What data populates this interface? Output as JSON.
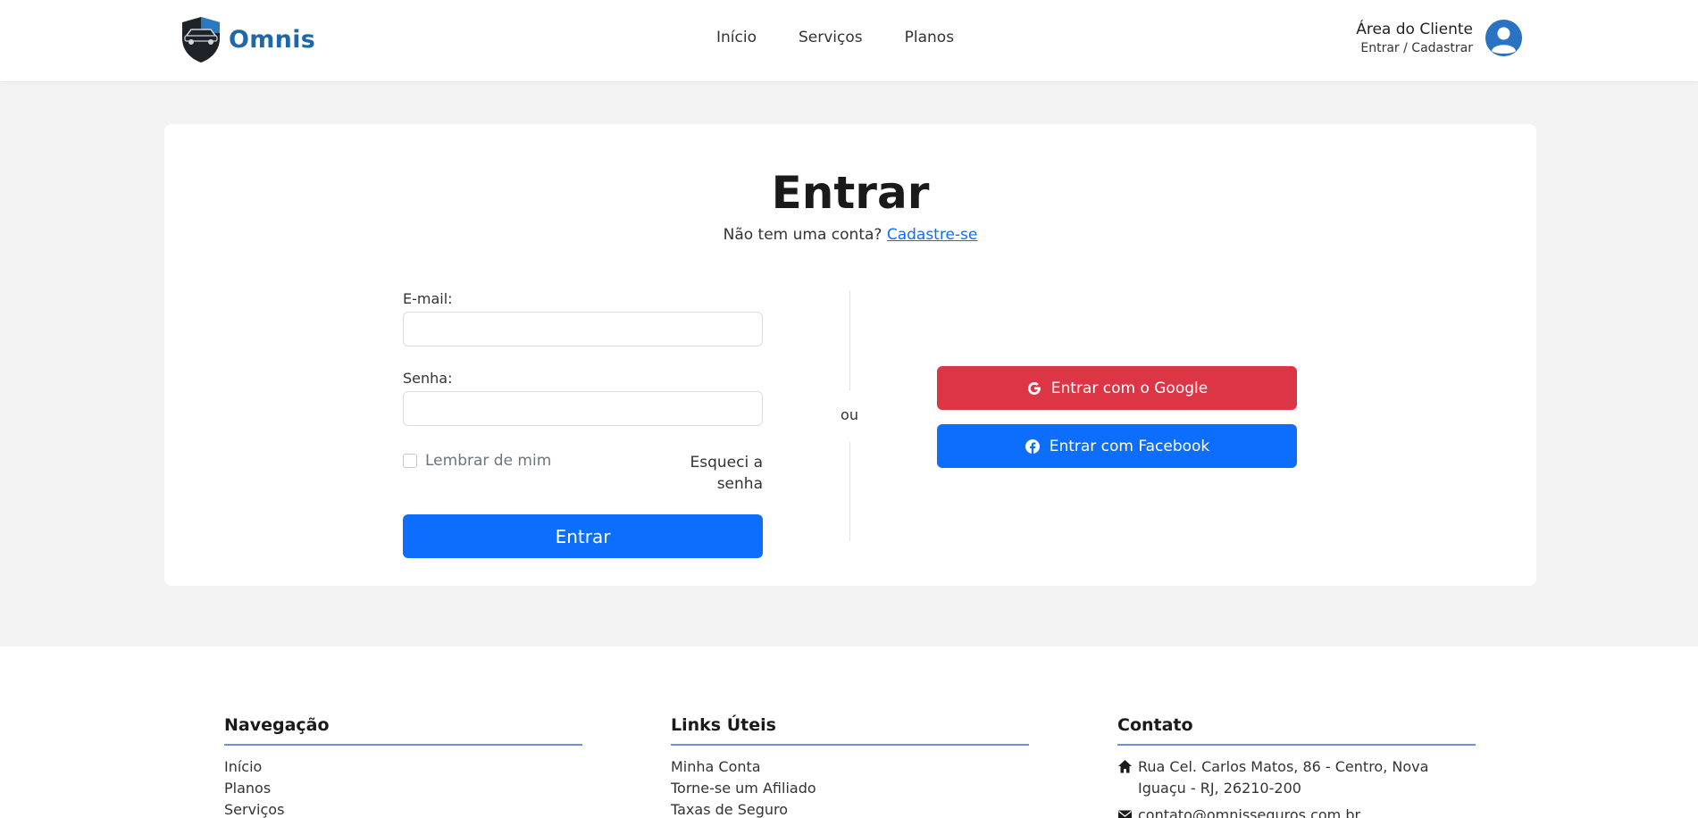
{
  "header": {
    "logo_text": "Omnis",
    "nav": [
      "Início",
      "Serviços",
      "Planos"
    ],
    "client_title": "Área do Cliente",
    "client_sub": "Entrar / Cadastrar"
  },
  "login": {
    "title": "Entrar",
    "no_account": "Não tem uma conta?",
    "signup_link": "Cadastre-se",
    "email_label": "E-mail:",
    "email_value": "",
    "password_label": "Senha:",
    "password_value": "",
    "remember_label": "Lembrar de mim",
    "forgot_label": "Esqueci a senha",
    "submit_label": "Entrar",
    "or_label": "ou",
    "google_label": "Entrar com o Google",
    "facebook_label": "Entrar com Facebook"
  },
  "footer": {
    "nav_title": "Navegação",
    "nav_items": [
      "Início",
      "Planos",
      "Serviços"
    ],
    "links_title": "Links Úteis",
    "links_items": [
      "Minha Conta",
      "Torne-se um Afiliado",
      "Taxas de Seguro"
    ],
    "contact_title": "Contato",
    "address": "Rua Cel. Carlos Matos, 86 - Centro, Nova Iguaçu - RJ, 26210-200",
    "email": "contato@omnisseguros.com.br"
  },
  "colors": {
    "primary": "#0d6efd",
    "google": "#dc3545",
    "logo": "#2067a8",
    "accent_line": "#6f8fd6"
  },
  "icons": {
    "logo": "shield-car-icon",
    "avatar": "user-avatar-icon",
    "google": "google-icon",
    "facebook": "facebook-icon",
    "address": "home-icon",
    "email": "envelope-icon"
  }
}
